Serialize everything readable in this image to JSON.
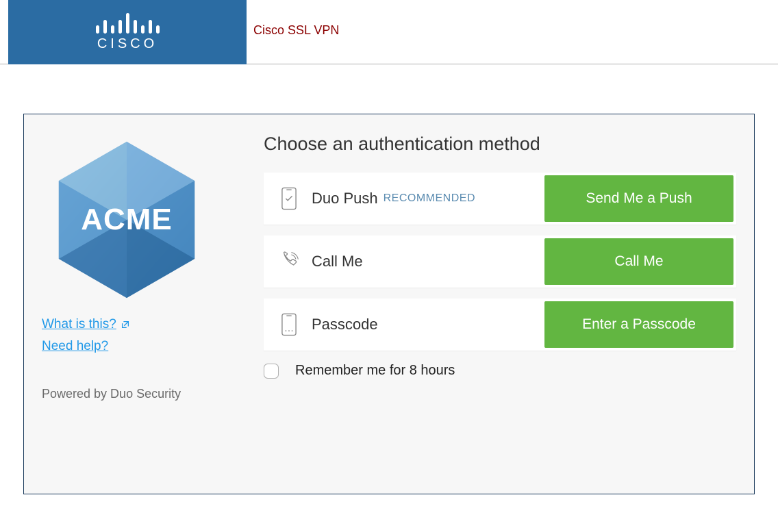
{
  "header": {
    "brand_text": "CISCO",
    "title": "Cisco SSL VPN"
  },
  "sidebar": {
    "org_name": "ACME",
    "link_what": "What is this?",
    "link_help": "Need help?",
    "powered": "Powered by Duo Security"
  },
  "main": {
    "heading": "Choose an authentication method",
    "methods": [
      {
        "label": "Duo Push",
        "badge": "RECOMMENDED",
        "button": "Send Me a Push",
        "icon": "phone-check-icon"
      },
      {
        "label": "Call Me",
        "badge": "",
        "button": "Call Me",
        "icon": "phone-call-icon"
      },
      {
        "label": "Passcode",
        "badge": "",
        "button": "Enter a Passcode",
        "icon": "phone-keypad-icon"
      }
    ],
    "remember_label": "Remember me for 8 hours"
  },
  "colors": {
    "cisco_blue": "#2b6ca3",
    "action_green": "#62b641",
    "link_blue": "#2199e8"
  }
}
